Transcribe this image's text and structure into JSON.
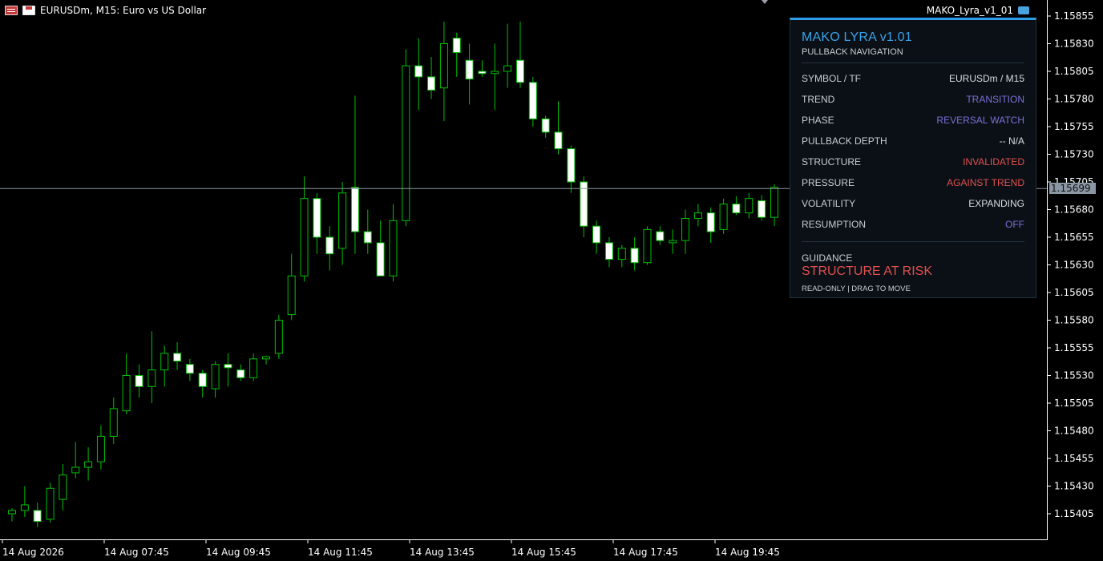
{
  "header": {
    "symbol_info": "EURUSDm, M15:  Euro vs US Dollar",
    "indicator_name": "MAKO_Lyra_v1_01",
    "icons": [
      "chart-grid-icon",
      "save-icon",
      "graduation-cap-icon"
    ]
  },
  "current_price": "1.15699",
  "colors": {
    "background": "#000000",
    "bull_candle": "#00c000",
    "bear_candle": "#ffffff",
    "price_line": "#8a96a3",
    "panel_accent": "#2f9ee8",
    "purple": "#7e6fd6",
    "red": "#e3504e"
  },
  "panel": {
    "title": "MAKO LYRA v1.01",
    "subtitle": "PULLBACK NAVIGATION",
    "rows": [
      {
        "key": "SYMBOL / TF",
        "value": "EURUSDm / M15",
        "color": "#d9dde2"
      },
      {
        "key": "TREND",
        "value": "TRANSITION",
        "color": "#7e6fd6"
      },
      {
        "key": "PHASE",
        "value": "REVERSAL WATCH",
        "color": "#7e6fd6"
      },
      {
        "key": "PULLBACK DEPTH",
        "value": "--  N/A",
        "color": "#d9dde2"
      },
      {
        "key": "STRUCTURE",
        "value": "INVALIDATED",
        "color": "#e3504e"
      },
      {
        "key": "PRESSURE",
        "value": "AGAINST TREND",
        "color": "#e3504e"
      },
      {
        "key": "VOLATILITY",
        "value": "EXPANDING",
        "color": "#d9dde2"
      },
      {
        "key": "RESUMPTION",
        "value": "OFF",
        "color": "#7e6fd6"
      }
    ],
    "guidance_label": "GUIDANCE",
    "guidance_value": "STRUCTURE AT RISK",
    "footer": "READ-ONLY  |  DRAG TO MOVE"
  },
  "chart_data": {
    "type": "candlestick",
    "title": "EURUSDm, M15:  Euro vs US Dollar",
    "y_ticks": [
      "1.15855",
      "1.15830",
      "1.15805",
      "1.15780",
      "1.15755",
      "1.15730",
      "1.15705",
      "1.15680",
      "1.15655",
      "1.15630",
      "1.15605",
      "1.15580",
      "1.15555",
      "1.15530",
      "1.15505",
      "1.15480",
      "1.15455",
      "1.15430",
      "1.15405"
    ],
    "x_ticks": [
      "14 Aug 2026",
      "14 Aug 07:45",
      "14 Aug 09:45",
      "14 Aug 11:45",
      "14 Aug 13:45",
      "14 Aug 15:45",
      "14 Aug 17:45",
      "14 Aug 19:45"
    ],
    "ylim": [
      1.1539,
      1.1587
    ],
    "candles": [
      {
        "o": 1.15405,
        "h": 1.1541,
        "l": 1.15398,
        "c": 1.15408
      },
      {
        "o": 1.15408,
        "h": 1.1543,
        "l": 1.15402,
        "c": 1.15413
      },
      {
        "o": 1.15408,
        "h": 1.15415,
        "l": 1.15393,
        "c": 1.15398
      },
      {
        "o": 1.154,
        "h": 1.15433,
        "l": 1.15397,
        "c": 1.15428
      },
      {
        "o": 1.15418,
        "h": 1.1545,
        "l": 1.15408,
        "c": 1.1544
      },
      {
        "o": 1.15442,
        "h": 1.1547,
        "l": 1.15437,
        "c": 1.15447
      },
      {
        "o": 1.15447,
        "h": 1.15465,
        "l": 1.15435,
        "c": 1.15452
      },
      {
        "o": 1.15452,
        "h": 1.15485,
        "l": 1.15445,
        "c": 1.15475
      },
      {
        "o": 1.15475,
        "h": 1.1551,
        "l": 1.15468,
        "c": 1.155
      },
      {
        "o": 1.15498,
        "h": 1.1555,
        "l": 1.15495,
        "c": 1.1553
      },
      {
        "o": 1.1553,
        "h": 1.1554,
        "l": 1.1551,
        "c": 1.1552
      },
      {
        "o": 1.1552,
        "h": 1.1557,
        "l": 1.15505,
        "c": 1.15535
      },
      {
        "o": 1.15535,
        "h": 1.15557,
        "l": 1.1552,
        "c": 1.1555
      },
      {
        "o": 1.1555,
        "h": 1.1556,
        "l": 1.15535,
        "c": 1.15543
      },
      {
        "o": 1.1554,
        "h": 1.15545,
        "l": 1.15525,
        "c": 1.15532
      },
      {
        "o": 1.15532,
        "h": 1.15535,
        "l": 1.1551,
        "c": 1.1552
      },
      {
        "o": 1.15518,
        "h": 1.15543,
        "l": 1.1551,
        "c": 1.1554
      },
      {
        "o": 1.1554,
        "h": 1.1555,
        "l": 1.1552,
        "c": 1.15537
      },
      {
        "o": 1.15535,
        "h": 1.1554,
        "l": 1.15525,
        "c": 1.15528
      },
      {
        "o": 1.15528,
        "h": 1.1555,
        "l": 1.15525,
        "c": 1.15545
      },
      {
        "o": 1.15545,
        "h": 1.15548,
        "l": 1.1554,
        "c": 1.15547
      },
      {
        "o": 1.1555,
        "h": 1.15585,
        "l": 1.15545,
        "c": 1.1558
      },
      {
        "o": 1.15585,
        "h": 1.1564,
        "l": 1.1558,
        "c": 1.1562
      },
      {
        "o": 1.1562,
        "h": 1.1571,
        "l": 1.15615,
        "c": 1.1569
      },
      {
        "o": 1.1569,
        "h": 1.15695,
        "l": 1.1564,
        "c": 1.15655
      },
      {
        "o": 1.15655,
        "h": 1.15665,
        "l": 1.15625,
        "c": 1.1564
      },
      {
        "o": 1.15645,
        "h": 1.15705,
        "l": 1.1563,
        "c": 1.15695
      },
      {
        "o": 1.157,
        "h": 1.15783,
        "l": 1.1564,
        "c": 1.1566
      },
      {
        "o": 1.1566,
        "h": 1.1568,
        "l": 1.1564,
        "c": 1.1565
      },
      {
        "o": 1.1565,
        "h": 1.1567,
        "l": 1.1562,
        "c": 1.1562
      },
      {
        "o": 1.1562,
        "h": 1.15685,
        "l": 1.15615,
        "c": 1.1567
      },
      {
        "o": 1.1567,
        "h": 1.15825,
        "l": 1.15665,
        "c": 1.1581
      },
      {
        "o": 1.1581,
        "h": 1.15835,
        "l": 1.1577,
        "c": 1.158
      },
      {
        "o": 1.158,
        "h": 1.15818,
        "l": 1.1578,
        "c": 1.15788
      },
      {
        "o": 1.1579,
        "h": 1.1585,
        "l": 1.1576,
        "c": 1.1583
      },
      {
        "o": 1.15835,
        "h": 1.1584,
        "l": 1.158,
        "c": 1.15822
      },
      {
        "o": 1.15815,
        "h": 1.1583,
        "l": 1.15775,
        "c": 1.15798
      },
      {
        "o": 1.15805,
        "h": 1.15815,
        "l": 1.158,
        "c": 1.15803
      },
      {
        "o": 1.15803,
        "h": 1.1583,
        "l": 1.1577,
        "c": 1.15805
      },
      {
        "o": 1.15805,
        "h": 1.15848,
        "l": 1.1579,
        "c": 1.1581
      },
      {
        "o": 1.15815,
        "h": 1.1585,
        "l": 1.1579,
        "c": 1.15795
      },
      {
        "o": 1.15795,
        "h": 1.158,
        "l": 1.15755,
        "c": 1.15762
      },
      {
        "o": 1.15762,
        "h": 1.15765,
        "l": 1.15745,
        "c": 1.1575
      },
      {
        "o": 1.1575,
        "h": 1.15778,
        "l": 1.1573,
        "c": 1.15735
      },
      {
        "o": 1.15735,
        "h": 1.15738,
        "l": 1.15695,
        "c": 1.15705
      },
      {
        "o": 1.15705,
        "h": 1.1571,
        "l": 1.15655,
        "c": 1.15665
      },
      {
        "o": 1.15665,
        "h": 1.1567,
        "l": 1.1564,
        "c": 1.1565
      },
      {
        "o": 1.1565,
        "h": 1.15655,
        "l": 1.15628,
        "c": 1.15635
      },
      {
        "o": 1.15635,
        "h": 1.15648,
        "l": 1.15628,
        "c": 1.15645
      },
      {
        "o": 1.15645,
        "h": 1.15655,
        "l": 1.15625,
        "c": 1.15632
      },
      {
        "o": 1.15632,
        "h": 1.15665,
        "l": 1.1563,
        "c": 1.15662
      },
      {
        "o": 1.1566,
        "h": 1.15665,
        "l": 1.15648,
        "c": 1.15652
      },
      {
        "o": 1.1565,
        "h": 1.15662,
        "l": 1.1564,
        "c": 1.15652
      },
      {
        "o": 1.15652,
        "h": 1.1568,
        "l": 1.1564,
        "c": 1.15672
      },
      {
        "o": 1.15672,
        "h": 1.15685,
        "l": 1.15665,
        "c": 1.15677
      },
      {
        "o": 1.15677,
        "h": 1.15682,
        "l": 1.1565,
        "c": 1.1566
      },
      {
        "o": 1.15662,
        "h": 1.1569,
        "l": 1.15658,
        "c": 1.15685
      },
      {
        "o": 1.15685,
        "h": 1.15692,
        "l": 1.15675,
        "c": 1.15677
      },
      {
        "o": 1.15677,
        "h": 1.15695,
        "l": 1.15672,
        "c": 1.1569
      },
      {
        "o": 1.15688,
        "h": 1.15693,
        "l": 1.1567,
        "c": 1.15673
      },
      {
        "o": 1.15673,
        "h": 1.15703,
        "l": 1.15665,
        "c": 1.157
      }
    ]
  }
}
